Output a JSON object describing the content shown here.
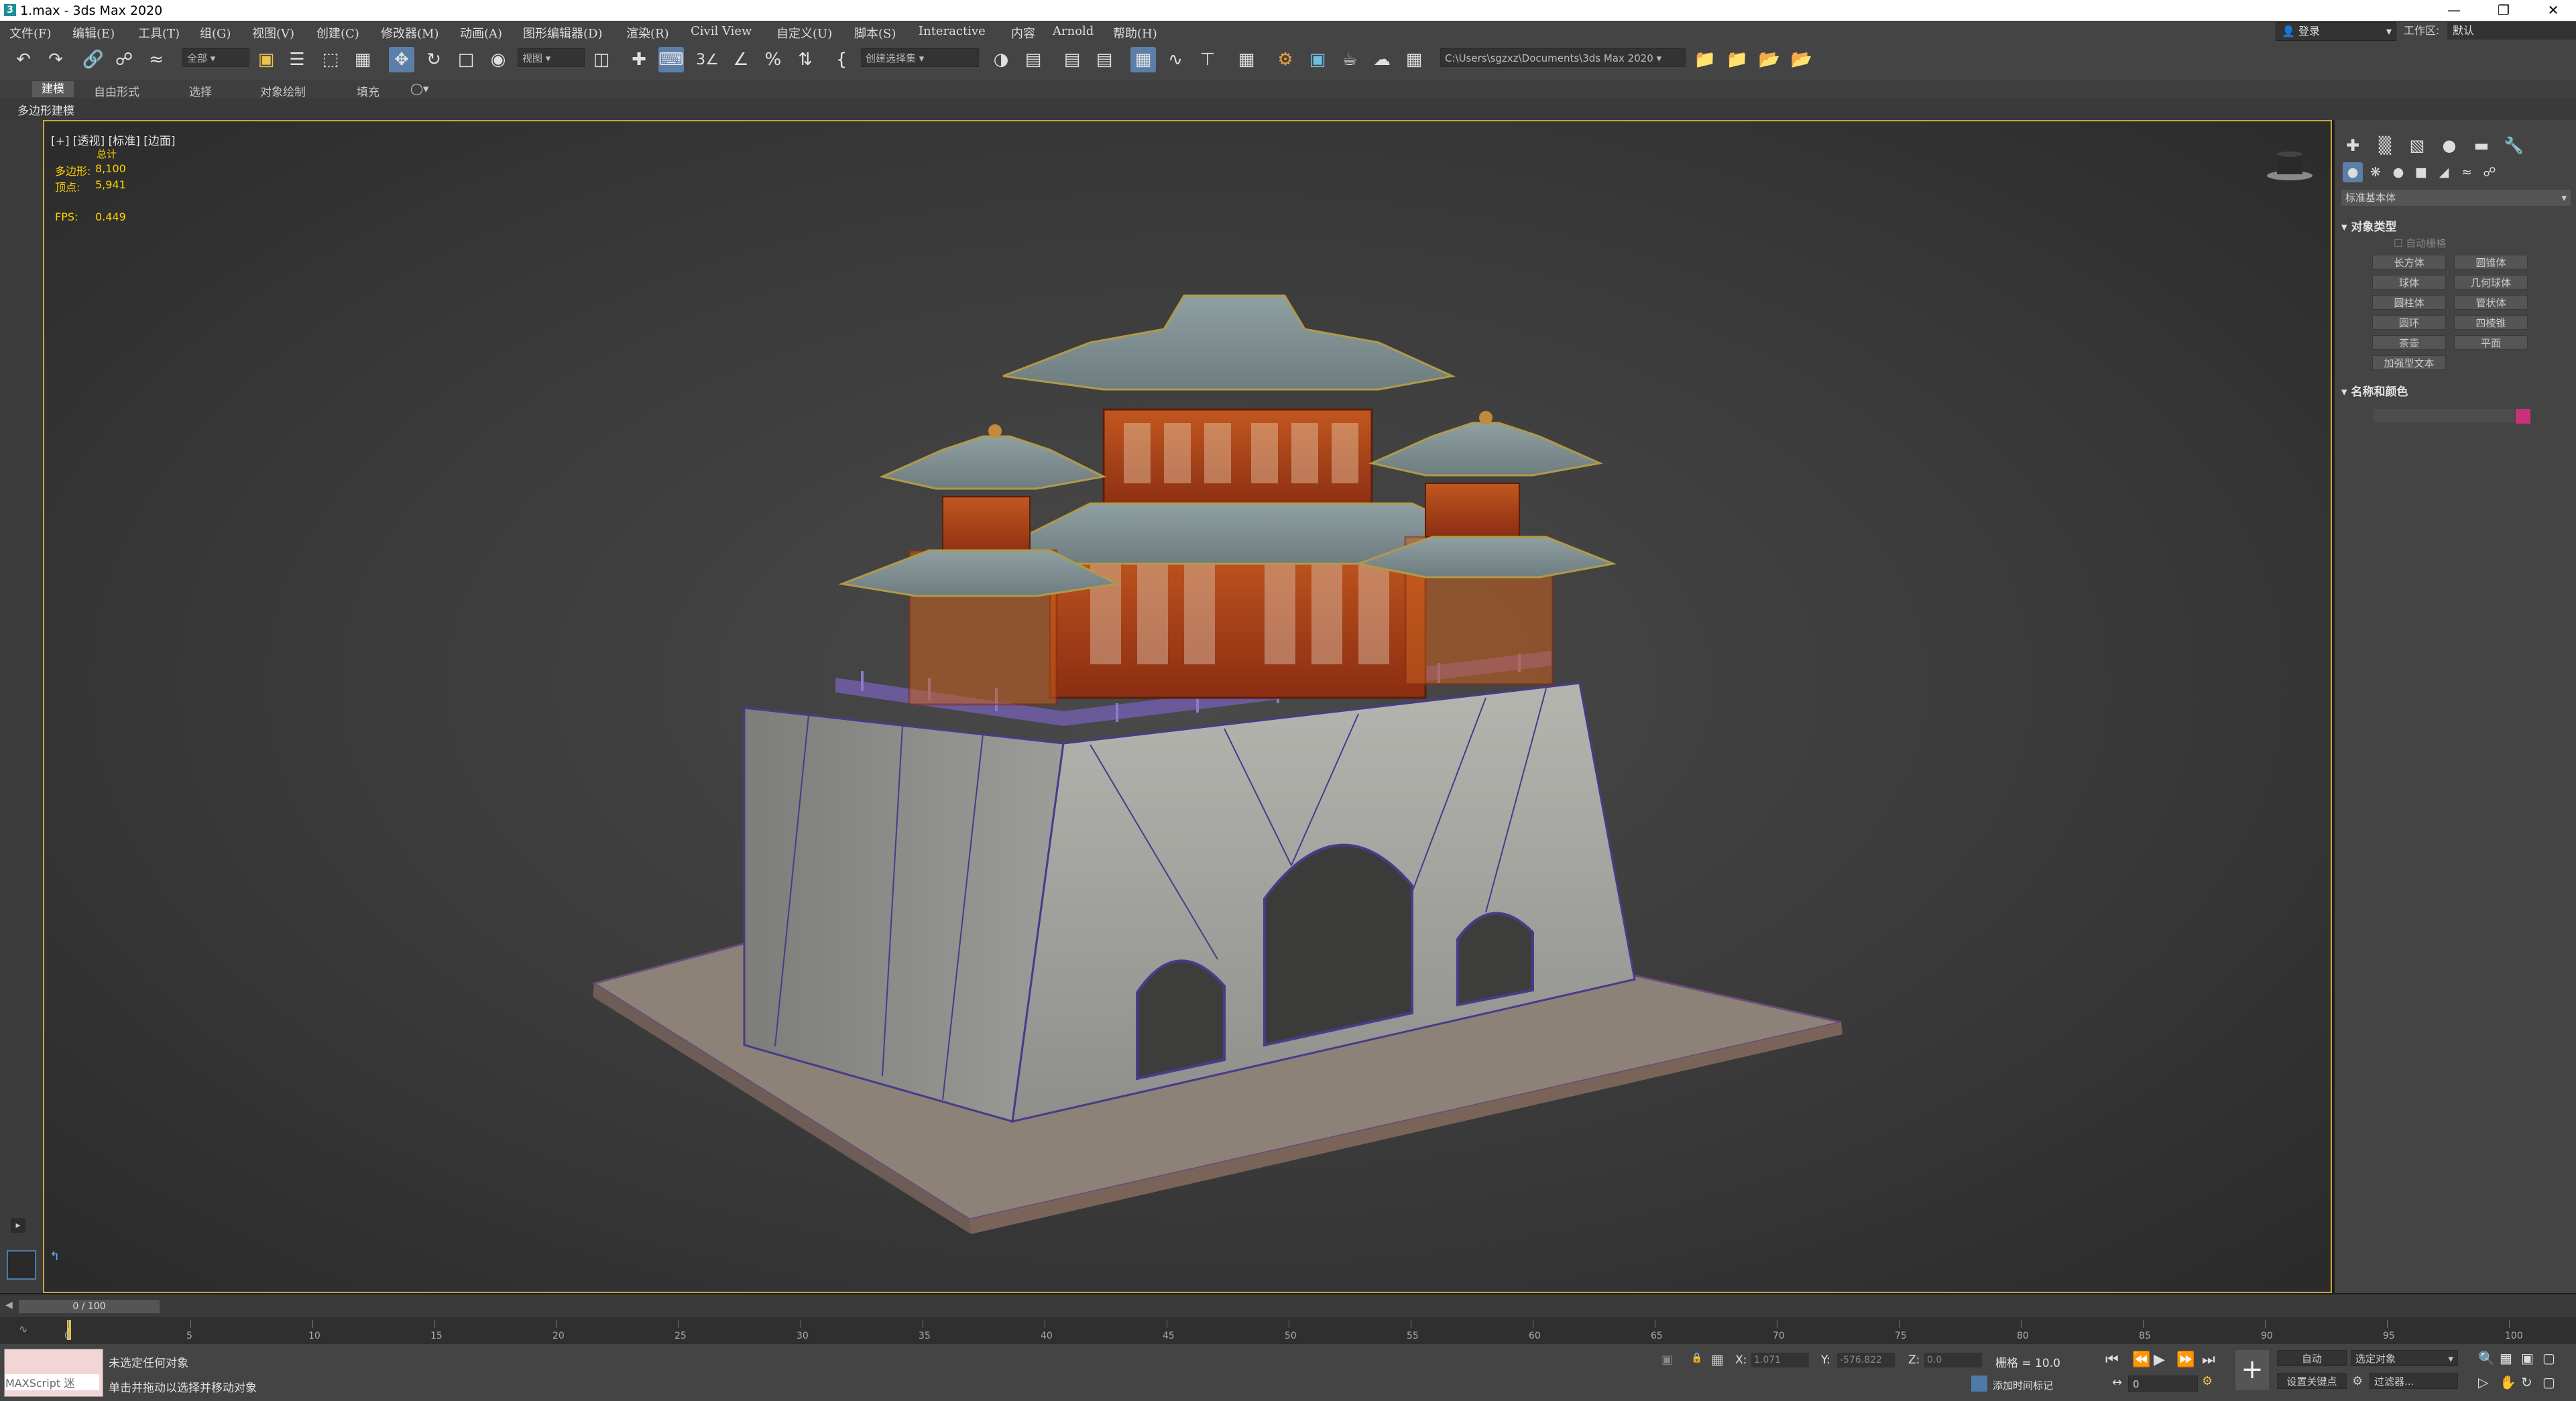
{
  "window": {
    "title": "1.max - 3ds Max 2020",
    "app_icon": "3"
  },
  "menu": [
    "文件(F)",
    "编辑(E)",
    "工具(T)",
    "组(G)",
    "视图(V)",
    "创建(C)",
    "修改器(M)",
    "动画(A)",
    "图形编辑器(D)",
    "渲染(R)",
    "Civil View",
    "自定义(U)",
    "脚本(S)",
    "Interactive",
    "内容",
    "Arnold",
    "帮助(H)"
  ],
  "account": {
    "login": "登录",
    "workspace_label": "工作区:",
    "workspace_value": "默认"
  },
  "toolbar": {
    "selection_filter": "全部",
    "ref_coord": "视图",
    "named_selection": "创建选择集",
    "project_path": "C:\\Users\\sgzxz\\Documents\\3ds Max 2020"
  },
  "ribbon": {
    "tabs": [
      "建模",
      "自由形式",
      "选择",
      "对象绘制",
      "填充"
    ],
    "panel_label": "多边形建模"
  },
  "viewport": {
    "label": "[+] [透视] [标准] [边面]",
    "stats": {
      "total_label": "总计",
      "poly_label": "多边形:",
      "poly_value": "8,100",
      "vert_label": "顶点:",
      "vert_value": "5,941",
      "fps_label": "FPS:",
      "fps_value": "0.449"
    }
  },
  "command_panel": {
    "category": "标准基本体",
    "object_type_header": "对象类型",
    "autogrid": "自动栅格",
    "buttons": [
      "长方体",
      "圆锥体",
      "球体",
      "几何球体",
      "圆柱体",
      "管状体",
      "圆环",
      "四棱锥",
      "茶壶",
      "平面",
      "加强型文本"
    ],
    "name_color_header": "名称和颜色",
    "object_color": "#c8327c"
  },
  "timeline": {
    "frame_display": "0 / 100",
    "ticks": [
      "0",
      "5",
      "10",
      "15",
      "20",
      "25",
      "30",
      "35",
      "40",
      "45",
      "50",
      "55",
      "60",
      "65",
      "70",
      "75",
      "80",
      "85",
      "90",
      "95",
      "100"
    ]
  },
  "status": {
    "maxscript": "MAXScript 迷",
    "line1": "未选定任何对象",
    "line2": "单击并拖动以选择并移动对象",
    "x_label": "X:",
    "x_value": "1.071",
    "y_label": "Y:",
    "y_value": "-576.822",
    "z_label": "Z:",
    "z_value": "0.0",
    "grid": "栅格 = 10.0",
    "add_time_tag": "添加时间标记",
    "auto": "自动",
    "selected_object": "选定对象",
    "set_key": "设置关键点",
    "filters": "过滤器...",
    "frame_value": "0"
  }
}
